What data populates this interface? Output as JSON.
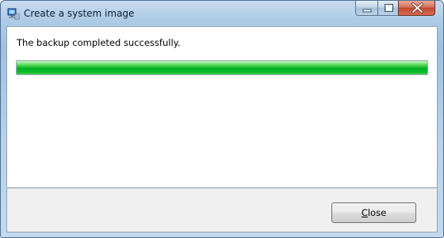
{
  "window": {
    "title": "Create a system image",
    "app_icon": "backup-computer-icon",
    "controls": {
      "minimize_icon": "minimize-icon",
      "maximize_icon": "maximize-icon",
      "close_icon": "close-icon"
    }
  },
  "content": {
    "status_message": "The backup completed successfully.",
    "progress": {
      "fraction": 1.0,
      "color": "#06b025"
    }
  },
  "footer": {
    "close_button": {
      "mnemonic": "C",
      "rest": "lose"
    }
  }
}
